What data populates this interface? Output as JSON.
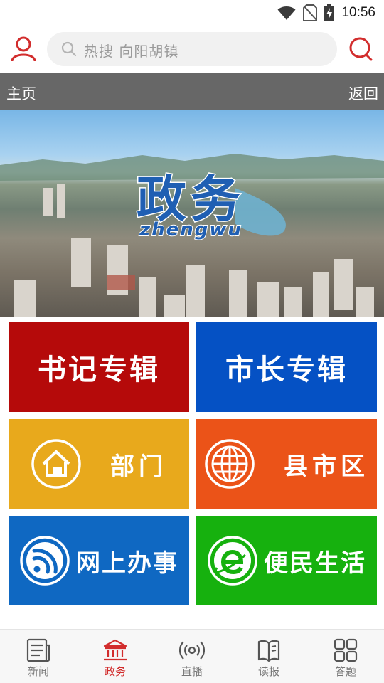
{
  "status_bar": {
    "time": "10:56",
    "icons": [
      "wifi-icon",
      "no-sim-icon",
      "battery-charging-icon"
    ]
  },
  "header": {
    "search_placeholder": "热搜 向阳胡镇",
    "accent_color": "#d22d2d"
  },
  "nav": {
    "title": "主页",
    "back_label": "返回"
  },
  "banner": {
    "title": "政务",
    "subtitle": "zhengwu"
  },
  "tiles": [
    {
      "label": "书记专辑",
      "color": "#b50a0a"
    },
    {
      "label": "市长专辑",
      "color": "#0551c4"
    },
    {
      "label": "部门",
      "color": "#e8a91c",
      "icon": "home-icon"
    },
    {
      "label": "县市区",
      "color": "#eb5318",
      "icon": "globe-icon"
    },
    {
      "label": "网上办事",
      "color": "#0f68c2",
      "icon": "rss-icon"
    },
    {
      "label": "便民生活",
      "color": "#16b10e",
      "icon": "ie-browser-icon"
    }
  ],
  "bottom_nav": [
    {
      "label": "新闻",
      "icon": "newspaper-icon",
      "active": false
    },
    {
      "label": "政务",
      "icon": "government-building-icon",
      "active": true
    },
    {
      "label": "直播",
      "icon": "broadcast-icon",
      "active": false
    },
    {
      "label": "读报",
      "icon": "book-icon",
      "active": false
    },
    {
      "label": "答题",
      "icon": "grid-icon",
      "active": false
    }
  ]
}
